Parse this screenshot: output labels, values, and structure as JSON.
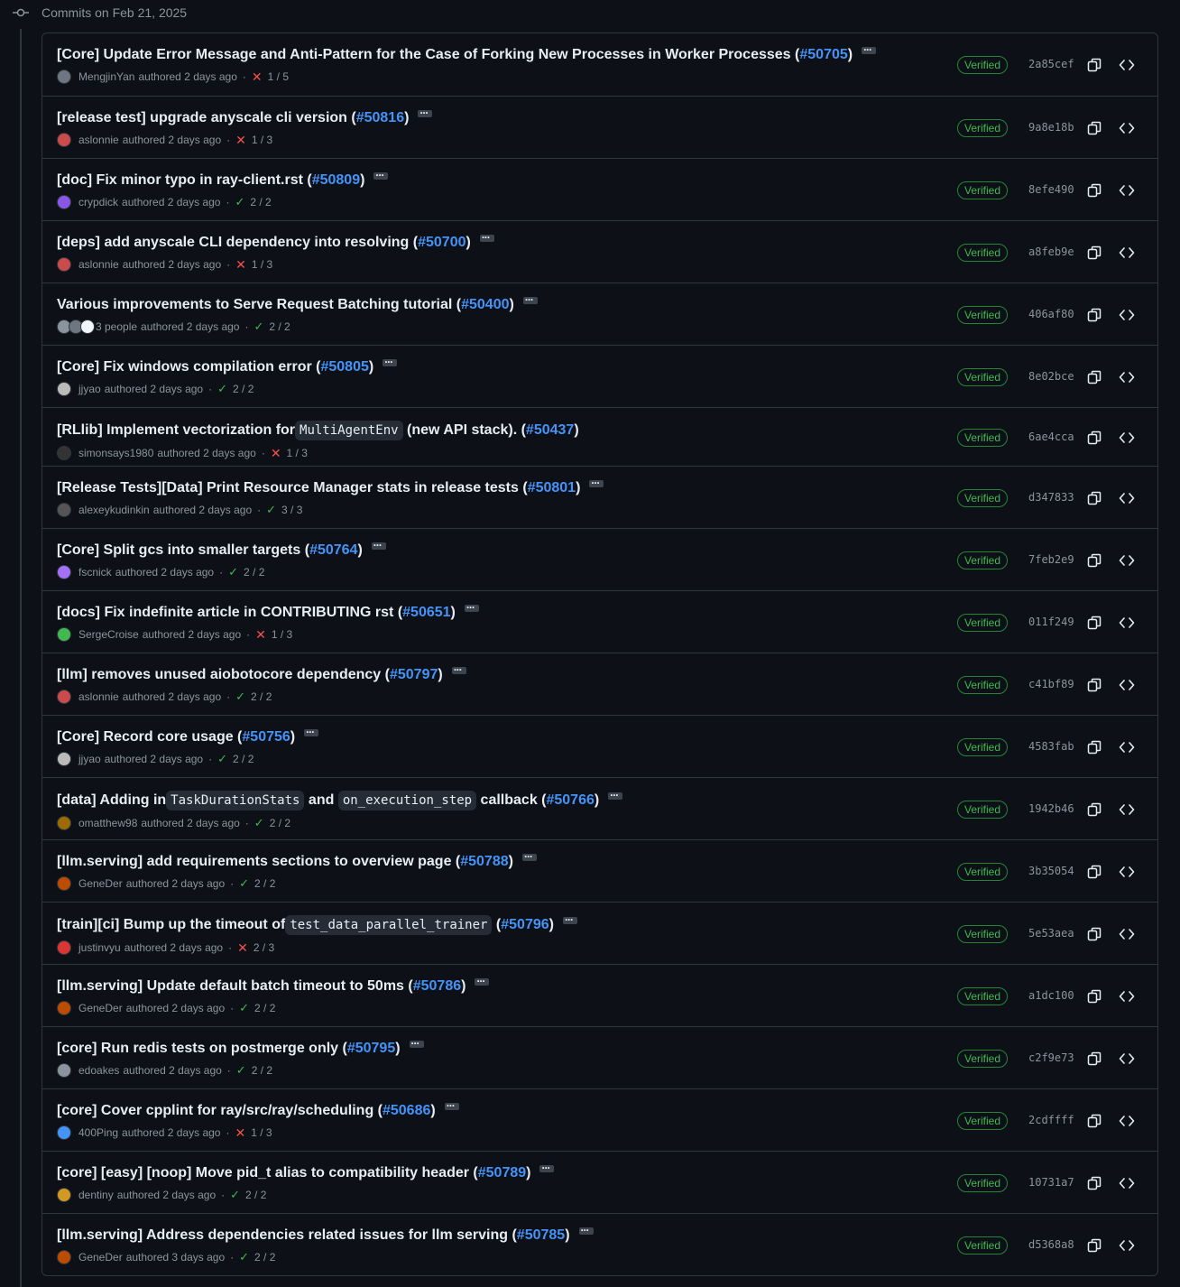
{
  "group": {
    "title": "Commits on Feb 21, 2025"
  },
  "colors": {
    "verified": "#3fb950",
    "pr_link": "#4493f8",
    "fail": "#f85149",
    "pass": "#3fb950"
  },
  "commits": [
    {
      "title": "[Core] Update Error Message and Anti-Pattern for the Case of Forking New Processes in Worker Processes (",
      "pr": "#50705",
      "close": ")",
      "author": "MengjinYan",
      "time": "authored 2 days ago",
      "status": "fail",
      "checks": "1 / 5",
      "verified": "Verified",
      "sha": "2a85cef"
    },
    {
      "title": "[release test] upgrade anyscale cli version (",
      "pr": "#50816",
      "close": ")",
      "author": "aslonnie",
      "time": "authored 2 days ago",
      "status": "fail",
      "checks": "1 / 3",
      "verified": "Verified",
      "sha": "9a8e18b"
    },
    {
      "title": "[doc] Fix minor typo in ray-client.rst (",
      "pr": "#50809",
      "close": ")",
      "author": "crypdick",
      "time": "authored 2 days ago",
      "status": "pass",
      "checks": "2 / 2",
      "verified": "Verified",
      "sha": "8efe490"
    },
    {
      "title": "[deps] add anyscale CLI dependency into resolving (",
      "pr": "#50700",
      "close": ")",
      "author": "aslonnie",
      "time": "authored 2 days ago",
      "status": "fail",
      "checks": "1 / 3",
      "verified": "Verified",
      "sha": "a8feb9e"
    },
    {
      "title": "Various improvements to Serve Request Batching tutorial (",
      "pr": "#50400",
      "close": ")",
      "author": "3 people",
      "time": "authored 2 days ago",
      "status": "pass",
      "checks": "2 / 2",
      "verified": "Verified",
      "sha": "406af80"
    },
    {
      "title": "[Core] Fix windows compilation error (",
      "pr": "#50805",
      "close": ")",
      "author": "jjyao",
      "time": "authored 2 days ago",
      "status": "pass",
      "checks": "2 / 2",
      "verified": "Verified",
      "sha": "8e02bce"
    },
    {
      "title": "[RLlib] Implement vectorization for ",
      "code1": "MultiAgentEnv",
      "title2": " (new API stack). (",
      "pr": "#50437",
      "close": ")",
      "author": "simonsays1980",
      "time": "authored 2 days ago",
      "status": "fail",
      "checks": "1 / 3",
      "verified": "Verified",
      "sha": "6ae4cca",
      "no_ellipsis": true
    },
    {
      "title": "[Release Tests][Data] Print Resource Manager stats in release tests (",
      "pr": "#50801",
      "close": ")",
      "author": "alexeykudinkin",
      "time": "authored 2 days ago",
      "status": "pass",
      "checks": "3 / 3",
      "verified": "Verified",
      "sha": "d347833"
    },
    {
      "title": "[Core] Split gcs into smaller targets (",
      "pr": "#50764",
      "close": ")",
      "author": "fscnick",
      "time": "authored 2 days ago",
      "status": "pass",
      "checks": "2 / 2",
      "verified": "Verified",
      "sha": "7feb2e9"
    },
    {
      "title": "[docs] Fix indefinite article in CONTRIBUTING rst (",
      "pr": "#50651",
      "close": ")",
      "author": "SergeCroise",
      "time": "authored 2 days ago",
      "status": "fail",
      "checks": "1 / 3",
      "verified": "Verified",
      "sha": "011f249"
    },
    {
      "title": "[llm] removes unused aiobotocore dependency (",
      "pr": "#50797",
      "close": ")",
      "author": "aslonnie",
      "time": "authored 2 days ago",
      "status": "pass",
      "checks": "2 / 2",
      "verified": "Verified",
      "sha": "c41bf89"
    },
    {
      "title": "[Core] Record core usage (",
      "pr": "#50756",
      "close": ")",
      "author": "jjyao",
      "time": "authored 2 days ago",
      "status": "pass",
      "checks": "2 / 2",
      "verified": "Verified",
      "sha": "4583fab"
    },
    {
      "title": "[data] Adding in ",
      "code1": "TaskDurationStats",
      "title2": " and ",
      "code2": "on_execution_step",
      "title3": " callback (",
      "pr": "#50766",
      "close": ")",
      "author": "omatthew98",
      "time": "authored 2 days ago",
      "status": "pass",
      "checks": "2 / 2",
      "verified": "Verified",
      "sha": "1942b46"
    },
    {
      "title": "[llm.serving] add requirements sections to overview page (",
      "pr": "#50788",
      "close": ")",
      "author": "GeneDer",
      "time": "authored 2 days ago",
      "status": "pass",
      "checks": "2 / 2",
      "verified": "Verified",
      "sha": "3b35054"
    },
    {
      "title": "[train][ci] Bump up the timeout of ",
      "code1": "test_data_parallel_trainer",
      "title2": " (",
      "pr": "#50796",
      "close": ")",
      "author": "justinvyu",
      "time": "authored 2 days ago",
      "status": "fail",
      "checks": "2 / 3",
      "verified": "Verified",
      "sha": "5e53aea"
    },
    {
      "title": "[llm.serving] Update default batch timeout to 50ms (",
      "pr": "#50786",
      "close": ")",
      "author": "GeneDer",
      "time": "authored 2 days ago",
      "status": "pass",
      "checks": "2 / 2",
      "verified": "Verified",
      "sha": "a1dc100"
    },
    {
      "title": "[core] Run redis tests on postmerge only (",
      "pr": "#50795",
      "close": ")",
      "author": "edoakes",
      "time": "authored 2 days ago",
      "status": "pass",
      "checks": "2 / 2",
      "verified": "Verified",
      "sha": "c2f9e73"
    },
    {
      "title": "[core] Cover cpplint for ray/src/ray/scheduling (",
      "pr": "#50686",
      "close": ")",
      "author": "400Ping",
      "time": "authored 2 days ago",
      "status": "fail",
      "checks": "1 / 3",
      "verified": "Verified",
      "sha": "2cdffff"
    },
    {
      "title": "[core] [easy] [noop] Move pid_t alias to compatibility header (",
      "pr": "#50789",
      "close": ")",
      "author": "dentiny",
      "time": "authored 2 days ago",
      "status": "pass",
      "checks": "2 / 2",
      "verified": "Verified",
      "sha": "10731a7"
    },
    {
      "title": "[llm.serving] Address dependencies related issues for llm serving (",
      "pr": "#50785",
      "close": ")",
      "author": "GeneDer",
      "time": "authored 3 days ago",
      "status": "pass",
      "checks": "2 / 2",
      "verified": "Verified",
      "sha": "d5368a8"
    }
  ]
}
